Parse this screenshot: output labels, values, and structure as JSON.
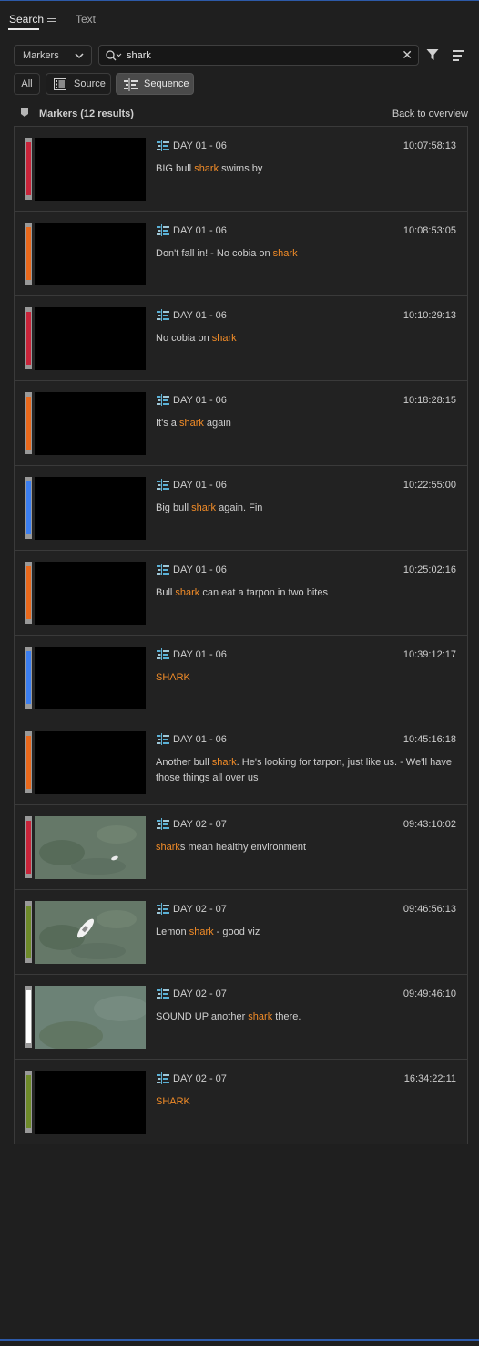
{
  "panel": {
    "tabs": [
      {
        "label": "Search",
        "active": true
      },
      {
        "label": "Text",
        "active": false
      }
    ]
  },
  "search": {
    "scope_dropdown": "Markers",
    "query": "shark"
  },
  "filters": {
    "all_label": "All",
    "source_label": "Source",
    "sequence_label": "Sequence",
    "selected": "Sequence"
  },
  "section": {
    "title": "Markers (12 results)",
    "back_label": "Back to overview"
  },
  "colors": {
    "highlight": "#f28c28",
    "red": "#c8243a",
    "orange": "#e9691c",
    "blue": "#3b7ef0",
    "green": "#6e8a2a",
    "white": "#ffffff"
  },
  "results": [
    {
      "clip": "DAY 01 - 06",
      "timecode": "10:07:58:13",
      "marker_color": "red",
      "thumb": "black",
      "comment": [
        {
          "t": "BIG bull "
        },
        {
          "t": "shark",
          "hl": true
        },
        {
          "t": " swims by"
        }
      ]
    },
    {
      "clip": "DAY 01 - 06",
      "timecode": "10:08:53:05",
      "marker_color": "orange",
      "thumb": "black",
      "comment": [
        {
          "t": "Don't fall in! - No cobia on "
        },
        {
          "t": "shark",
          "hl": true
        }
      ]
    },
    {
      "clip": "DAY 01 - 06",
      "timecode": "10:10:29:13",
      "marker_color": "red",
      "thumb": "black",
      "comment": [
        {
          "t": "No cobia on "
        },
        {
          "t": "shark",
          "hl": true
        }
      ]
    },
    {
      "clip": "DAY 01 - 06",
      "timecode": "10:18:28:15",
      "marker_color": "orange",
      "thumb": "black",
      "comment": [
        {
          "t": "It's a "
        },
        {
          "t": "shark",
          "hl": true
        },
        {
          "t": " again"
        }
      ]
    },
    {
      "clip": "DAY 01 - 06",
      "timecode": "10:22:55:00",
      "marker_color": "blue",
      "thumb": "black",
      "comment": [
        {
          "t": "Big bull "
        },
        {
          "t": "shark",
          "hl": true
        },
        {
          "t": " again. Fin"
        }
      ]
    },
    {
      "clip": "DAY 01 - 06",
      "timecode": "10:25:02:16",
      "marker_color": "orange",
      "thumb": "black",
      "comment": [
        {
          "t": "Bull "
        },
        {
          "t": "shark",
          "hl": true
        },
        {
          "t": " can eat a tarpon in two bites"
        }
      ]
    },
    {
      "clip": "DAY 01 - 06",
      "timecode": "10:39:12:17",
      "marker_color": "blue",
      "thumb": "black",
      "comment": [
        {
          "t": "SHARK",
          "hl": true
        }
      ]
    },
    {
      "clip": "DAY 01 - 06",
      "timecode": "10:45:16:18",
      "marker_color": "orange",
      "thumb": "black",
      "comment": [
        {
          "t": "Another bull "
        },
        {
          "t": "shark",
          "hl": true
        },
        {
          "t": ". He's looking for tarpon, just like us.  - We'll have those things all over us"
        }
      ]
    },
    {
      "clip": "DAY 02 - 07",
      "timecode": "09:43:10:02",
      "marker_color": "red",
      "thumb": "water-boat-small",
      "comment": [
        {
          "t": "shark",
          "hl": true
        },
        {
          "t": "s mean healthy environment"
        }
      ]
    },
    {
      "clip": "DAY 02 - 07",
      "timecode": "09:46:56:13",
      "marker_color": "green",
      "thumb": "water-boat",
      "comment": [
        {
          "t": "Lemon "
        },
        {
          "t": "shark",
          "hl": true
        },
        {
          "t": " - good viz"
        }
      ]
    },
    {
      "clip": "DAY 02 - 07",
      "timecode": "09:49:46:10",
      "marker_color": "white",
      "thumb": "water",
      "comment": [
        {
          "t": "SOUND UP another "
        },
        {
          "t": "shark",
          "hl": true
        },
        {
          "t": " there."
        }
      ]
    },
    {
      "clip": "DAY 02 - 07",
      "timecode": "16:34:22:11",
      "marker_color": "green",
      "thumb": "black",
      "comment": [
        {
          "t": "SHARK",
          "hl": true
        }
      ]
    }
  ]
}
